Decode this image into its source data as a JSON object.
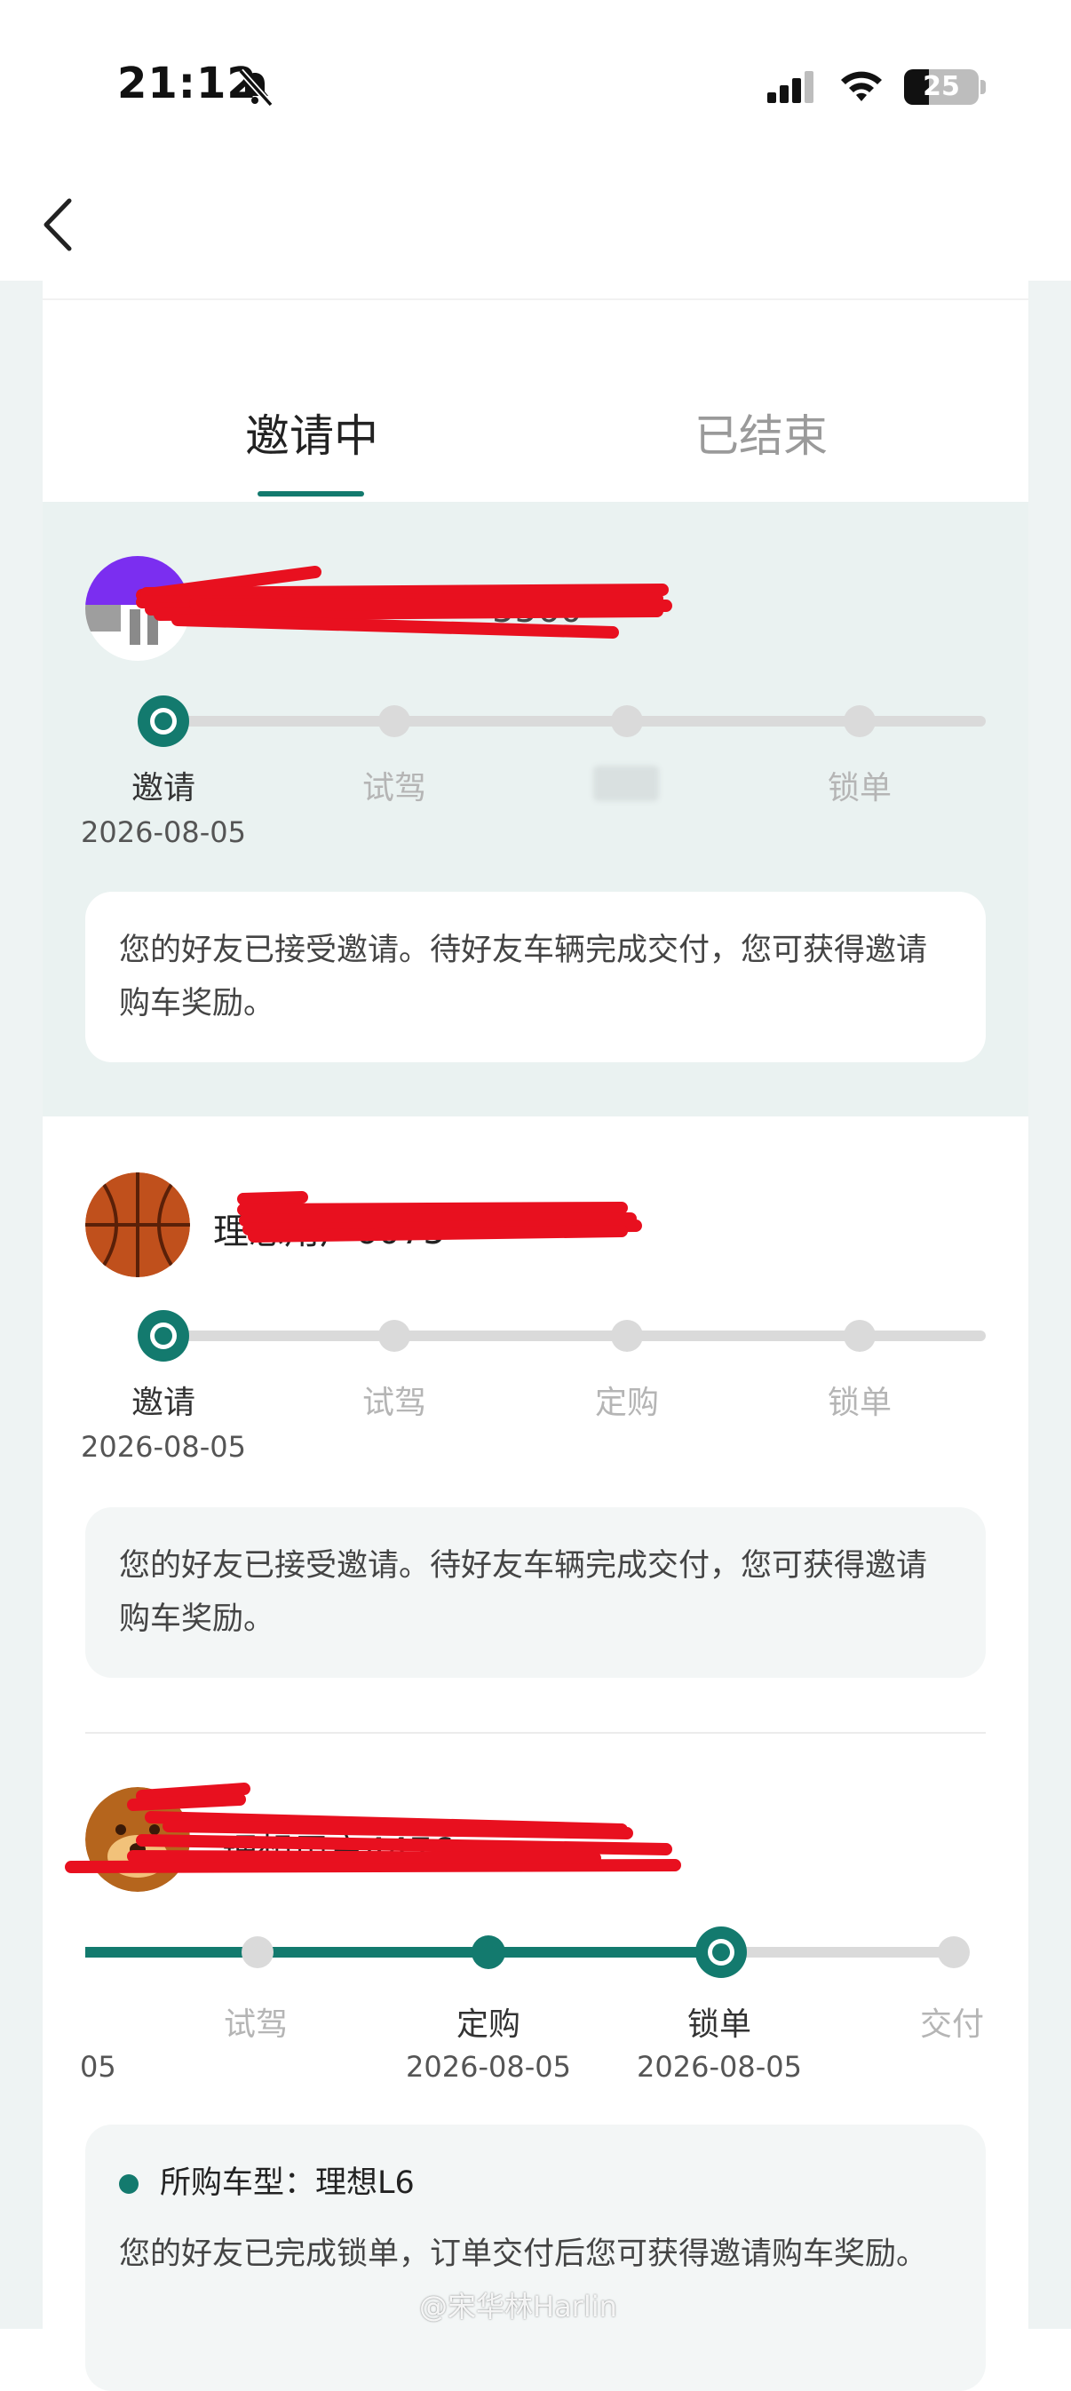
{
  "status_bar": {
    "time": "21:12",
    "battery": "25"
  },
  "tabs": [
    {
      "label": "邀请中",
      "active": true
    },
    {
      "label": "已结束",
      "active": false
    }
  ],
  "invites": [
    {
      "name_visible": "5560",
      "steps": [
        {
          "label": "邀请",
          "date": "2026-08-05"
        },
        {
          "label": "试驾"
        },
        {
          "label": ""
        },
        {
          "label": "锁单"
        }
      ],
      "current_step": 1,
      "message": "您的好友已接受邀请。待好友车辆完成交付，您可获得邀请购车奖励。"
    },
    {
      "name_visible": "理想用户6075",
      "steps": [
        {
          "label": "邀请",
          "date": "2026-08-05"
        },
        {
          "label": "试驾"
        },
        {
          "label": "定购"
        },
        {
          "label": "锁单"
        }
      ],
      "current_step": 1,
      "message": "您的好友已接受邀请。待好友车辆完成交付，您可获得邀请购车奖励。"
    },
    {
      "name_visible": "理想用户4476",
      "steps": [
        {
          "label": "",
          "date": "05"
        },
        {
          "label": "试驾"
        },
        {
          "label": "定购",
          "date": "2026-08-05"
        },
        {
          "label": "锁单",
          "date": "2026-08-05"
        },
        {
          "label": "交付"
        }
      ],
      "current_step": 4,
      "model_line": "所购车型：理想L6",
      "message": "您的好友已完成锁单，订单交付后您可获得邀请购车奖励。"
    }
  ],
  "watermark": "@宋华林Harlin",
  "colors": {
    "accent": "#137a6e",
    "redaction": "#e8101f"
  }
}
